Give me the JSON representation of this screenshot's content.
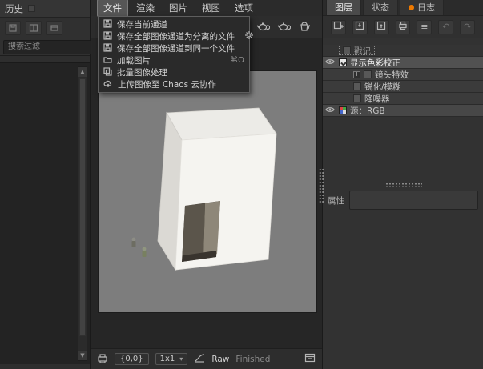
{
  "colors": {
    "accent_orange": "#ef7a00",
    "viewport_background": "#7d7d7d",
    "panel_background": "#323232",
    "selection": "#515151"
  },
  "left_panel": {
    "title": "历史",
    "search_placeholder": "搜索过滤"
  },
  "icons": {
    "up_arrow": "▲",
    "down_arrow": "▼",
    "dropdown_arrow": "▾",
    "list": "≡",
    "undo": "↶",
    "redo": "↷",
    "expander_plus": "+"
  },
  "menubar": {
    "items": [
      {
        "label": "文件"
      },
      {
        "label": "渲染"
      },
      {
        "label": "图片"
      },
      {
        "label": "视图"
      },
      {
        "label": "选项"
      }
    ]
  },
  "file_menu": {
    "items": [
      {
        "label": "保存当前通道"
      },
      {
        "label": "保存全部图像通道为分离的文件"
      },
      {
        "label": "保存全部图像通道到同一个文件"
      },
      {
        "label": "加载图片",
        "shortcut": "⌘O"
      },
      {
        "label": "批量图像处理"
      },
      {
        "label": "上传图像至 Chaos 云协作"
      }
    ]
  },
  "statusbar": {
    "coords": "{0,0}",
    "zoom": "1x1",
    "raw_label": "Raw",
    "status": "Finished"
  },
  "right_panel": {
    "tabs": [
      {
        "label": "图层"
      },
      {
        "label": "状态"
      },
      {
        "label": "日志"
      }
    ],
    "tree": [
      {
        "label": "戳记"
      },
      {
        "label": "显示色彩校正"
      },
      {
        "label": "镜头特效"
      },
      {
        "label": "锐化/模糊"
      },
      {
        "label": "降噪器"
      },
      {
        "label": "源：RGB"
      }
    ],
    "properties_label": "属性"
  }
}
